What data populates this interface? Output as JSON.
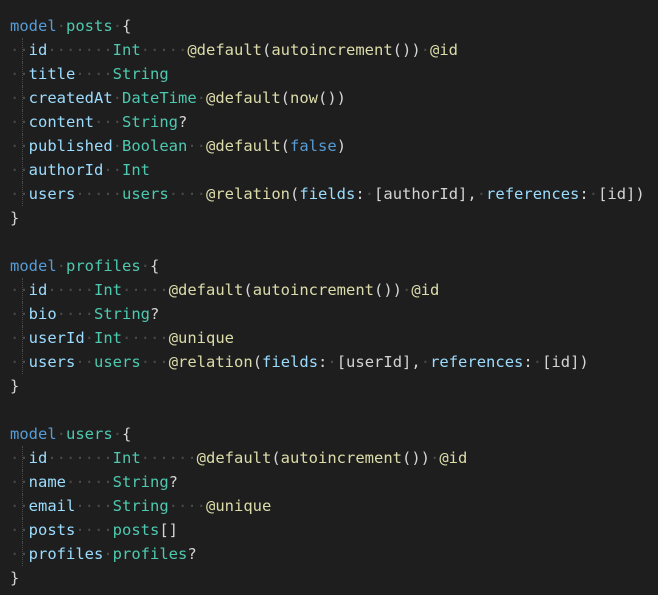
{
  "editor": {
    "language": "prisma",
    "colors": {
      "background": "#1e1e1e",
      "keyword": "#569cd6",
      "model_name": "#4ec9b0",
      "field_name": "#9cdcfe",
      "type": "#4ec9b0",
      "decorator": "#dcdcaa",
      "punctuation": "#d4d4d4",
      "whitespace_marker": "#4b4b4b"
    },
    "lines": [
      [
        {
          "k": "kw",
          "t": "model"
        },
        {
          "k": "sp",
          "t": "·"
        },
        {
          "k": "name",
          "t": "posts"
        },
        {
          "k": "sp",
          "t": "·"
        },
        {
          "k": "brace",
          "t": "{"
        }
      ],
      [
        {
          "k": "sp",
          "t": "··"
        },
        {
          "k": "field",
          "t": "id"
        },
        {
          "k": "sp",
          "t": "·······"
        },
        {
          "k": "type",
          "t": "Int"
        },
        {
          "k": "sp",
          "t": "·····"
        },
        {
          "k": "deco",
          "t": "@default"
        },
        {
          "k": "punc",
          "t": "("
        },
        {
          "k": "deco",
          "t": "autoincrement"
        },
        {
          "k": "punc",
          "t": "())"
        },
        {
          "k": "sp",
          "t": "·"
        },
        {
          "k": "deco",
          "t": "@id"
        }
      ],
      [
        {
          "k": "sp",
          "t": "··"
        },
        {
          "k": "field",
          "t": "title"
        },
        {
          "k": "sp",
          "t": "····"
        },
        {
          "k": "type",
          "t": "String"
        }
      ],
      [
        {
          "k": "sp",
          "t": "··"
        },
        {
          "k": "field",
          "t": "createdAt"
        },
        {
          "k": "sp",
          "t": "·"
        },
        {
          "k": "type",
          "t": "DateTime"
        },
        {
          "k": "sp",
          "t": "·"
        },
        {
          "k": "deco",
          "t": "@default"
        },
        {
          "k": "punc",
          "t": "("
        },
        {
          "k": "deco",
          "t": "now"
        },
        {
          "k": "punc",
          "t": "())"
        }
      ],
      [
        {
          "k": "sp",
          "t": "··"
        },
        {
          "k": "field",
          "t": "content"
        },
        {
          "k": "sp",
          "t": "···"
        },
        {
          "k": "type",
          "t": "String"
        },
        {
          "k": "punc",
          "t": "?"
        }
      ],
      [
        {
          "k": "sp",
          "t": "··"
        },
        {
          "k": "field",
          "t": "published"
        },
        {
          "k": "sp",
          "t": "·"
        },
        {
          "k": "type",
          "t": "Boolean"
        },
        {
          "k": "sp",
          "t": "··"
        },
        {
          "k": "deco",
          "t": "@default"
        },
        {
          "k": "punc",
          "t": "("
        },
        {
          "k": "bool",
          "t": "false"
        },
        {
          "k": "punc",
          "t": ")"
        }
      ],
      [
        {
          "k": "sp",
          "t": "··"
        },
        {
          "k": "field",
          "t": "authorId"
        },
        {
          "k": "sp",
          "t": "··"
        },
        {
          "k": "type",
          "t": "Int"
        }
      ],
      [
        {
          "k": "sp",
          "t": "··"
        },
        {
          "k": "field",
          "t": "users"
        },
        {
          "k": "sp",
          "t": "·····"
        },
        {
          "k": "type",
          "t": "users"
        },
        {
          "k": "sp",
          "t": "····"
        },
        {
          "k": "deco",
          "t": "@relation"
        },
        {
          "k": "punc",
          "t": "("
        },
        {
          "k": "attrkey",
          "t": "fields"
        },
        {
          "k": "punc",
          "t": ":"
        },
        {
          "k": "sp",
          "t": "·"
        },
        {
          "k": "punc",
          "t": "[authorId],"
        },
        {
          "k": "sp",
          "t": "·"
        },
        {
          "k": "attrkey",
          "t": "references"
        },
        {
          "k": "punc",
          "t": ":"
        },
        {
          "k": "sp",
          "t": "·"
        },
        {
          "k": "punc",
          "t": "[id])"
        }
      ],
      [
        {
          "k": "brace",
          "t": "}"
        }
      ],
      [],
      [
        {
          "k": "kw",
          "t": "model"
        },
        {
          "k": "sp",
          "t": "·"
        },
        {
          "k": "name",
          "t": "profiles"
        },
        {
          "k": "sp",
          "t": "·"
        },
        {
          "k": "brace",
          "t": "{"
        }
      ],
      [
        {
          "k": "sp",
          "t": "··"
        },
        {
          "k": "field",
          "t": "id"
        },
        {
          "k": "sp",
          "t": "·····"
        },
        {
          "k": "type",
          "t": "Int"
        },
        {
          "k": "sp",
          "t": "·····"
        },
        {
          "k": "deco",
          "t": "@default"
        },
        {
          "k": "punc",
          "t": "("
        },
        {
          "k": "deco",
          "t": "autoincrement"
        },
        {
          "k": "punc",
          "t": "())"
        },
        {
          "k": "sp",
          "t": "·"
        },
        {
          "k": "deco",
          "t": "@id"
        }
      ],
      [
        {
          "k": "sp",
          "t": "··"
        },
        {
          "k": "field",
          "t": "bio"
        },
        {
          "k": "sp",
          "t": "····"
        },
        {
          "k": "type",
          "t": "String"
        },
        {
          "k": "punc",
          "t": "?"
        }
      ],
      [
        {
          "k": "sp",
          "t": "··"
        },
        {
          "k": "field",
          "t": "userId"
        },
        {
          "k": "sp",
          "t": "·"
        },
        {
          "k": "type",
          "t": "Int"
        },
        {
          "k": "sp",
          "t": "·····"
        },
        {
          "k": "deco",
          "t": "@unique"
        }
      ],
      [
        {
          "k": "sp",
          "t": "··"
        },
        {
          "k": "field",
          "t": "users"
        },
        {
          "k": "sp",
          "t": "··"
        },
        {
          "k": "type",
          "t": "users"
        },
        {
          "k": "sp",
          "t": "···"
        },
        {
          "k": "deco",
          "t": "@relation"
        },
        {
          "k": "punc",
          "t": "("
        },
        {
          "k": "attrkey",
          "t": "fields"
        },
        {
          "k": "punc",
          "t": ":"
        },
        {
          "k": "sp",
          "t": "·"
        },
        {
          "k": "punc",
          "t": "[userId],"
        },
        {
          "k": "sp",
          "t": "·"
        },
        {
          "k": "attrkey",
          "t": "references"
        },
        {
          "k": "punc",
          "t": ":"
        },
        {
          "k": "sp",
          "t": "·"
        },
        {
          "k": "punc",
          "t": "[id])"
        }
      ],
      [
        {
          "k": "brace",
          "t": "}"
        }
      ],
      [],
      [
        {
          "k": "kw",
          "t": "model"
        },
        {
          "k": "sp",
          "t": "·"
        },
        {
          "k": "name",
          "t": "users"
        },
        {
          "k": "sp",
          "t": "·"
        },
        {
          "k": "brace",
          "t": "{"
        }
      ],
      [
        {
          "k": "sp",
          "t": "··"
        },
        {
          "k": "field",
          "t": "id"
        },
        {
          "k": "sp",
          "t": "·······"
        },
        {
          "k": "type",
          "t": "Int"
        },
        {
          "k": "sp",
          "t": "······"
        },
        {
          "k": "deco",
          "t": "@default"
        },
        {
          "k": "punc",
          "t": "("
        },
        {
          "k": "deco",
          "t": "autoincrement"
        },
        {
          "k": "punc",
          "t": "())"
        },
        {
          "k": "sp",
          "t": "·"
        },
        {
          "k": "deco",
          "t": "@id"
        }
      ],
      [
        {
          "k": "sp",
          "t": "··"
        },
        {
          "k": "field",
          "t": "name"
        },
        {
          "k": "sp",
          "t": "·····"
        },
        {
          "k": "type",
          "t": "String"
        },
        {
          "k": "punc",
          "t": "?"
        }
      ],
      [
        {
          "k": "sp",
          "t": "··"
        },
        {
          "k": "field",
          "t": "email"
        },
        {
          "k": "sp",
          "t": "····"
        },
        {
          "k": "type",
          "t": "String"
        },
        {
          "k": "sp",
          "t": "····"
        },
        {
          "k": "deco",
          "t": "@unique"
        }
      ],
      [
        {
          "k": "sp",
          "t": "··"
        },
        {
          "k": "field",
          "t": "posts"
        },
        {
          "k": "sp",
          "t": "····"
        },
        {
          "k": "type",
          "t": "posts"
        },
        {
          "k": "punc",
          "t": "[]"
        }
      ],
      [
        {
          "k": "sp",
          "t": "··"
        },
        {
          "k": "field",
          "t": "profiles"
        },
        {
          "k": "sp",
          "t": "·"
        },
        {
          "k": "type",
          "t": "profiles"
        },
        {
          "k": "punc",
          "t": "?"
        }
      ],
      [
        {
          "k": "brace",
          "t": "}"
        }
      ]
    ]
  }
}
